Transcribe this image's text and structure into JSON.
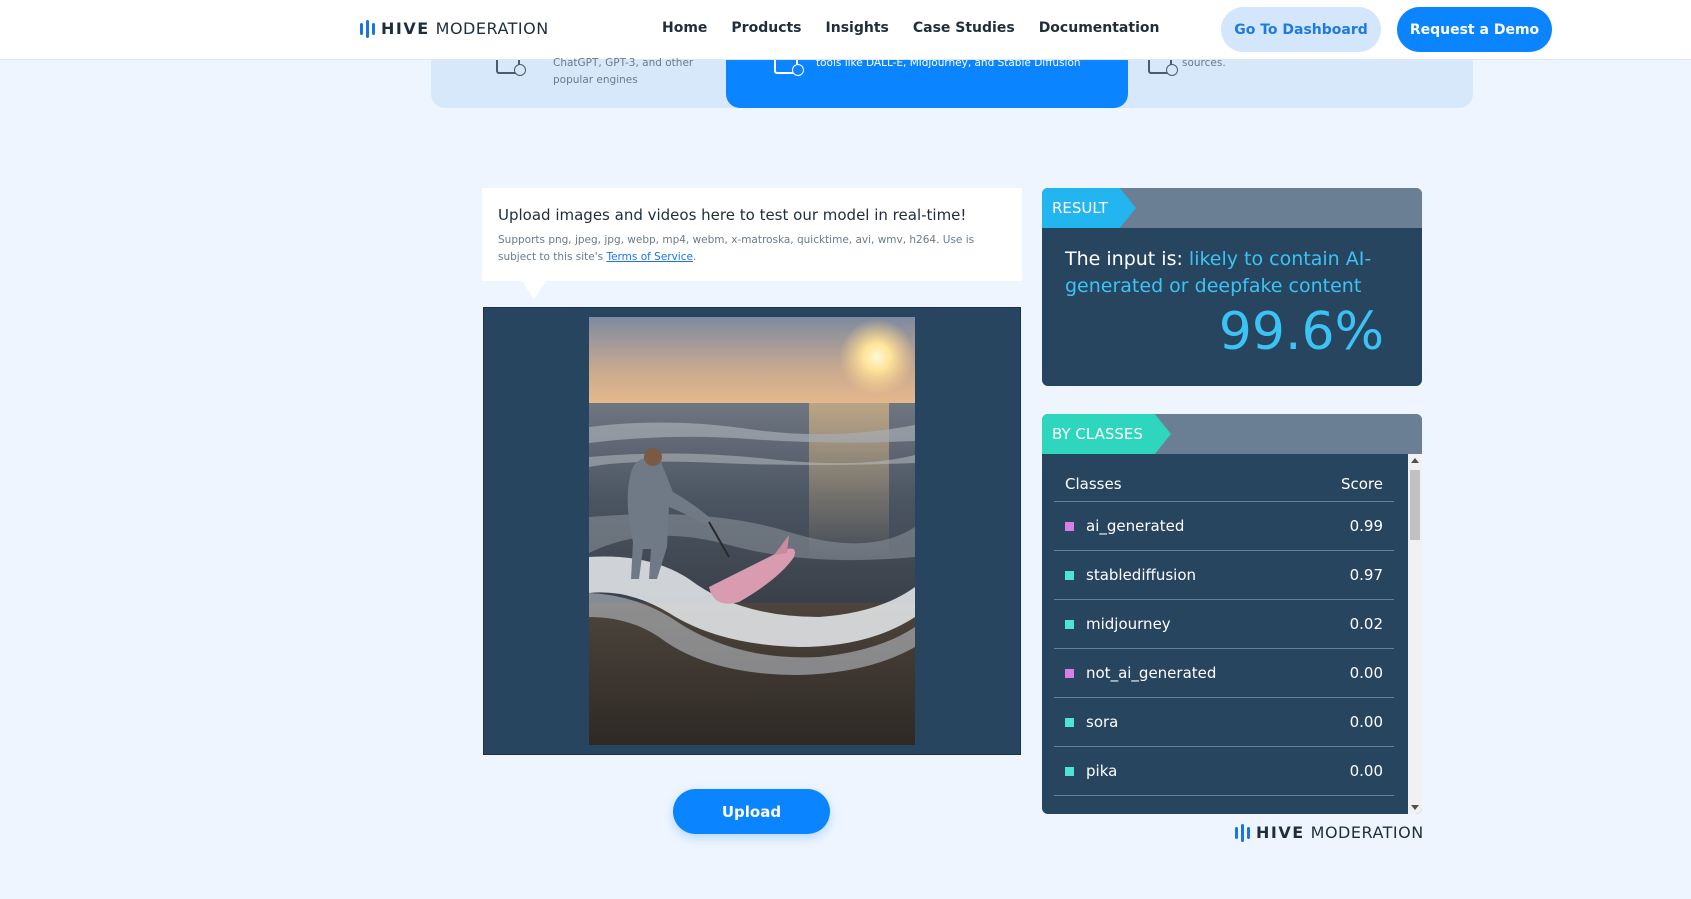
{
  "brand": {
    "name_bold": "HIVE",
    "name_light": "MODERATION"
  },
  "nav": {
    "items": [
      "Home",
      "Products",
      "Insights",
      "Case Studies",
      "Documentation"
    ]
  },
  "header": {
    "dashboard_label": "Go To Dashboard",
    "demo_label": "Request a Demo"
  },
  "strip": {
    "card1_text": "ChatGPT, GPT-3, and other popular engines",
    "card2_text": "tools like DALL-E, Midjourney, and Stable Diffusion",
    "card3_text": "sources."
  },
  "upload": {
    "title": "Upload images and videos here to test our model in real-time!",
    "supports": "Supports png, jpeg, jpg, webp, mp4, webm, x-matroska, quicktime, avi, wmv, h264. Use is subject to this site's",
    "terms_link": "Terms of Service",
    "terms_suffix": ".",
    "button_label": "Upload"
  },
  "result": {
    "tag": "RESULT",
    "prefix": "The input is: ",
    "verdict": "likely to contain AI-generated or deepfake content",
    "percent": "99.6%"
  },
  "by_classes": {
    "tag": "BY CLASSES",
    "col_classes": "Classes",
    "col_score": "Score",
    "rows": [
      {
        "name": "ai_generated",
        "score": "0.99",
        "color": "#d77ee8"
      },
      {
        "name": "stablediffusion",
        "score": "0.97",
        "color": "#4fe3d6"
      },
      {
        "name": "midjourney",
        "score": "0.02",
        "color": "#4fe3d6"
      },
      {
        "name": "not_ai_generated",
        "score": "0.00",
        "color": "#d77ee8"
      },
      {
        "name": "sora",
        "score": "0.00",
        "color": "#4fe3d6"
      },
      {
        "name": "pika",
        "score": "0.00",
        "color": "#4fe3d6"
      }
    ]
  },
  "colors": {
    "accent": "#0a84ff",
    "panel": "#27455f",
    "highlight": "#3cc3f5"
  }
}
